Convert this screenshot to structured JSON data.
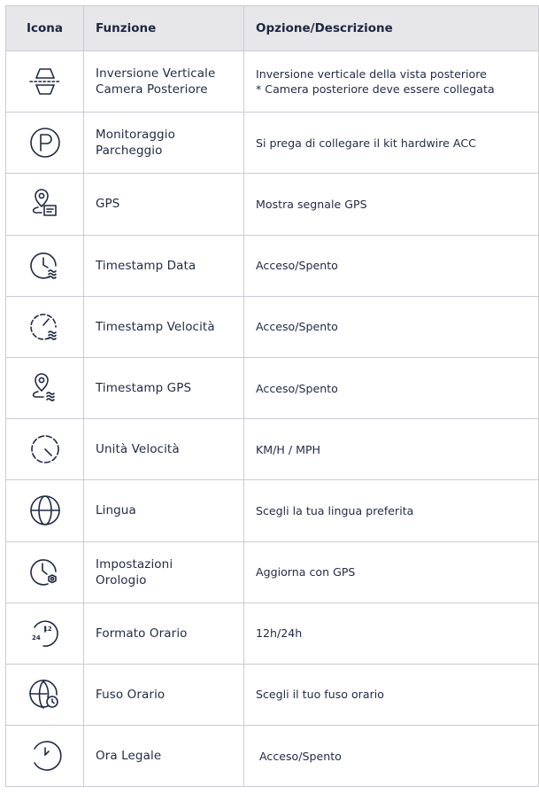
{
  "header": {
    "icon": "Icona",
    "function": "Funzione",
    "description": "Opzione/Descrizione"
  },
  "rows": [
    {
      "icon": "flip-camera-icon",
      "function": "Inversione Verticale\nCamera Posteriore",
      "description": "Inversione verticale della vista posteriore\n* Camera posteriore deve essere collegata"
    },
    {
      "icon": "parking-icon",
      "function": "Monitoraggio\nParcheggio",
      "description": "Si prega di collegare il kit hardwire ACC"
    },
    {
      "icon": "gps-icon",
      "function": "GPS",
      "description": "Mostra segnale GPS"
    },
    {
      "icon": "date-stamp-icon",
      "function": "Timestamp Data",
      "description": "Acceso/Spento"
    },
    {
      "icon": "speed-stamp-icon",
      "function": "Timestamp Velocità",
      "description": "Acceso/Spento"
    },
    {
      "icon": "gps-stamp-icon",
      "function": "Timestamp GPS",
      "description": "Acceso/Spento"
    },
    {
      "icon": "speed-unit-icon",
      "function": "Unità Velocità",
      "description": "KM/H / MPH"
    },
    {
      "icon": "globe-icon",
      "function": "Lingua",
      "description": "Scegli la tua lingua preferita"
    },
    {
      "icon": "clock-settings-icon",
      "function": "Impostazioni\nOrologio",
      "description": "Aggiorna con GPS"
    },
    {
      "icon": "time-format-icon",
      "function": "Formato Orario",
      "description": "12h/24h"
    },
    {
      "icon": "timezone-icon",
      "function": "Fuso Orario",
      "description": "Scegli il tuo fuso orario"
    },
    {
      "icon": "daylight-saving-icon",
      "function": "Ora Legale",
      "description": "Acceso/Spento"
    }
  ]
}
